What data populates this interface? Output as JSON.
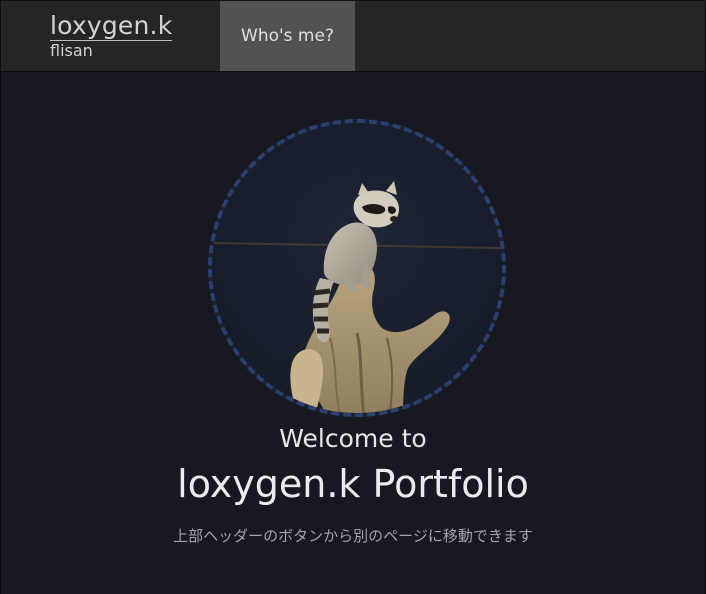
{
  "header": {
    "brand_title": "loxygen.k",
    "brand_subtitle": "flisan",
    "nav": [
      {
        "label": "Who's me?"
      }
    ]
  },
  "hero": {
    "welcome": "Welcome to",
    "title": "loxygen.k Portfolio",
    "description": "上部ヘッダーのボタンから別のページに移動できます"
  },
  "colors": {
    "page_background": "#181920",
    "header_background": "#252526",
    "nav_active_background": "#525254",
    "avatar_dashed_border": "#2c4070"
  },
  "icons": {
    "avatar": "raccoon-photo"
  }
}
